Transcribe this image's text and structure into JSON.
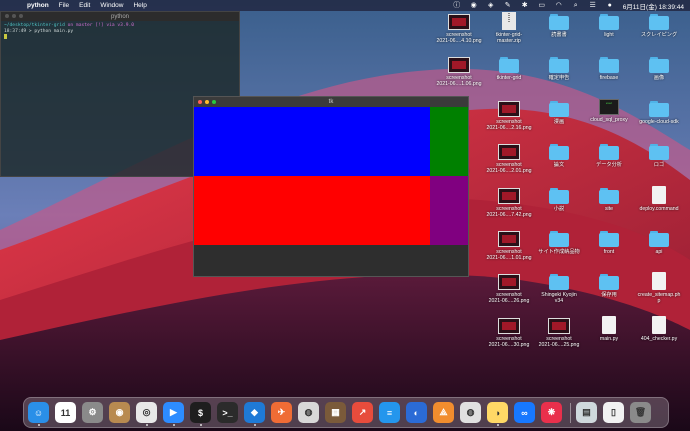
{
  "menubar": {
    "apple_icon": "apple-icon",
    "app_name": "python",
    "menus": [
      "File",
      "Edit",
      "Window",
      "Help"
    ],
    "clock": "6月11日(金)  18:39:44"
  },
  "terminal": {
    "title": "python",
    "prompt_line_path": "~/desktop/tkinter-grid",
    "prompt_line_rest": " on  master [!] via  v3.9.0",
    "command_line": "18:37:49 > python main.py"
  },
  "tk_window": {
    "title": "tk",
    "cells": [
      {
        "name": "blue",
        "color": "#0000ff"
      },
      {
        "name": "green",
        "color": "#008000"
      },
      {
        "name": "red",
        "color": "#ff0000"
      },
      {
        "name": "purple",
        "color": "#800080"
      }
    ]
  },
  "desktop": {
    "icons": [
      {
        "label": "screenshot\n2021-06....4.10.png",
        "kind": "thumb"
      },
      {
        "label": "tkinter-grid-\nmaster.zip",
        "kind": "zip"
      },
      {
        "label": "読書書",
        "kind": "folder"
      },
      {
        "label": "light",
        "kind": "folder"
      },
      {
        "label": "スクレイピング",
        "kind": "folder"
      },
      {
        "label": "screenshot\n2021-06....1.06.png",
        "kind": "thumb"
      },
      {
        "label": "tkinter-grid",
        "kind": "folder"
      },
      {
        "label": "確定申告",
        "kind": "folder"
      },
      {
        "label": "firebase",
        "kind": "folder"
      },
      {
        "label": "画像",
        "kind": "folder"
      },
      {
        "label": "shot\n....4.png",
        "kind": "none"
      },
      {
        "label": "screenshot\n2021-06....2.16.png",
        "kind": "thumb"
      },
      {
        "label": "漫画",
        "kind": "folder"
      },
      {
        "label": "cloud_sql_proxy",
        "kind": "exe"
      },
      {
        "label": "google-cloud-sdk",
        "kind": "folder"
      },
      {
        "label": "shot\n....0.png",
        "kind": "none"
      },
      {
        "label": "screenshot\n2021-06....2.01.png",
        "kind": "thumb"
      },
      {
        "label": "論文",
        "kind": "folder"
      },
      {
        "label": "データ分析",
        "kind": "folder"
      },
      {
        "label": "ロゴ",
        "kind": "folder"
      },
      {
        "label": "screenshot\n2021-06....7.42.png",
        "kind": "thumb"
      },
      {
        "label": "小説",
        "kind": "folder"
      },
      {
        "label": "site",
        "kind": "folder"
      },
      {
        "label": "deploy.command",
        "kind": "doc"
      },
      {
        "label": "screenshot\n2021-06....1.01.png",
        "kind": "thumb"
      },
      {
        "label": "サイト作成納品物",
        "kind": "folder"
      },
      {
        "label": "front",
        "kind": "folder"
      },
      {
        "label": "api",
        "kind": "folder"
      },
      {
        "label": "screenshot\n2021-06....26.png",
        "kind": "thumb"
      },
      {
        "label": "Shingeki Kyojin\nv34",
        "kind": "folder"
      },
      {
        "label": "保存用",
        "kind": "folder"
      },
      {
        "label": "create_sitemap.ph\np",
        "kind": "doc"
      },
      {
        "label": "screenshot\n2021-06....30.png",
        "kind": "thumb"
      },
      {
        "label": "screenshot\n2021-06....25.png",
        "kind": "thumb"
      },
      {
        "label": "main.py",
        "kind": "doc"
      },
      {
        "label": "404_checker.py",
        "kind": "doc"
      }
    ]
  },
  "dock": {
    "apps": [
      {
        "name": "finder",
        "color": "#2a8fe8",
        "glyph": "☺",
        "running": true
      },
      {
        "name": "calendar",
        "color": "#ffffff",
        "glyph": "11",
        "running": false
      },
      {
        "name": "system-preferences",
        "color": "#8a8a8a",
        "glyph": "⚙",
        "running": false
      },
      {
        "name": "contacts",
        "color": "#b88a50",
        "glyph": "◉",
        "running": false
      },
      {
        "name": "chrome",
        "color": "#e8e8e8",
        "glyph": "◎",
        "running": true
      },
      {
        "name": "zoom",
        "color": "#2d8cff",
        "glyph": "▶",
        "running": true
      },
      {
        "name": "iterm",
        "color": "#1e1e1e",
        "glyph": "$",
        "running": true
      },
      {
        "name": "terminal",
        "color": "#2b2b2b",
        "glyph": ">_",
        "running": false
      },
      {
        "name": "vscode",
        "color": "#1f7ad6",
        "glyph": "◆",
        "running": true
      },
      {
        "name": "postman",
        "color": "#ef6c35",
        "glyph": "✈",
        "running": false
      },
      {
        "name": "sequel-pro",
        "color": "#d8d8d8",
        "glyph": "◍",
        "running": false
      },
      {
        "name": "tableplus",
        "color": "#7a5a3a",
        "glyph": "▦",
        "running": false
      },
      {
        "name": "activity",
        "color": "#e74c3c",
        "glyph": "↗",
        "running": false
      },
      {
        "name": "docker",
        "color": "#2496ed",
        "glyph": "≡",
        "running": false
      },
      {
        "name": "proxyman",
        "color": "#2b6bd6",
        "glyph": "◐",
        "running": false
      },
      {
        "name": "sourcetree",
        "color": "#f18d2e",
        "glyph": "⟁",
        "running": false
      },
      {
        "name": "mysqlworkbench",
        "color": "#e0e0e0",
        "glyph": "◍",
        "running": false
      },
      {
        "name": "python",
        "color": "#ffd866",
        "glyph": "◑",
        "running": true
      },
      {
        "name": "infinity",
        "color": "#1778ff",
        "glyph": "∞",
        "running": false
      },
      {
        "name": "klokki",
        "color": "#e9304c",
        "glyph": "❋",
        "running": false
      }
    ],
    "right_items": [
      {
        "name": "preview",
        "color": "#cfd8dc",
        "glyph": "▤"
      },
      {
        "name": "document",
        "color": "#f2f2f2",
        "glyph": "▯"
      },
      {
        "name": "trash",
        "color": "#8a8a8a",
        "glyph": "🗑"
      }
    ]
  }
}
